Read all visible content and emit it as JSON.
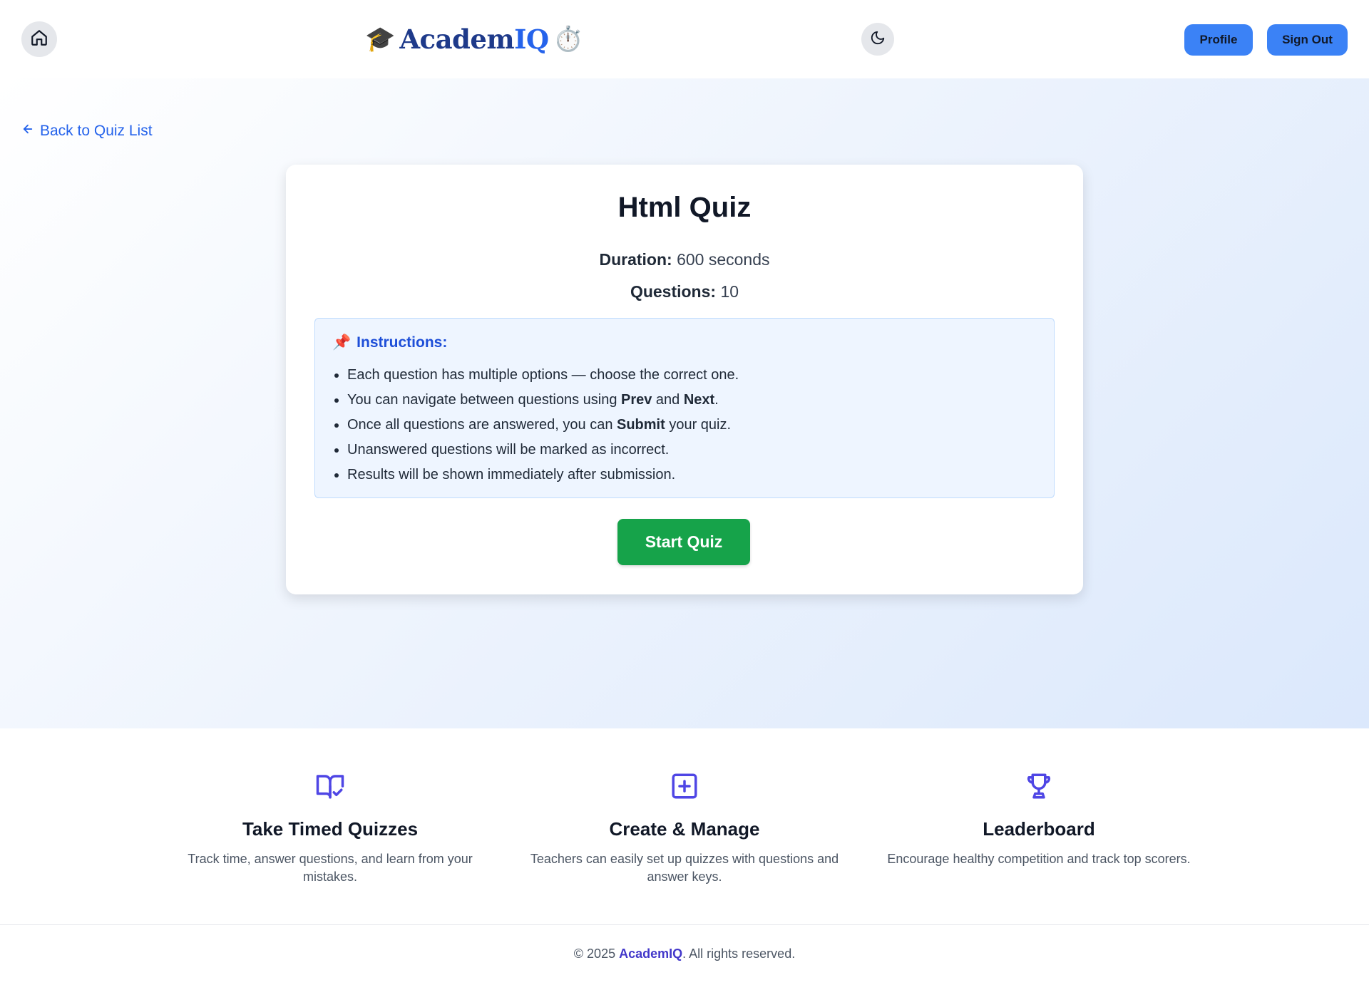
{
  "header": {
    "home_icon": "home-icon",
    "logo": {
      "prefix_emoji": "🎓",
      "brand_main": "Academ",
      "brand_accent": "IQ",
      "suffix_emoji": "⏱️"
    },
    "theme_icon": "moon-icon",
    "profile_label": "Profile",
    "signout_label": "Sign Out",
    "accent_color": "#3b82f6"
  },
  "back_link": {
    "icon": "arrow-left-icon",
    "label": "Back to Quiz List"
  },
  "quiz": {
    "title": "Html Quiz",
    "duration_label": "Duration:",
    "duration_value": "600 seconds",
    "questions_label": "Questions:",
    "questions_value": "10",
    "instructions": {
      "icon": "📌",
      "title": "Instructions:",
      "items": [
        {
          "before": "Each question has multiple options — choose the correct one.",
          "b1": "",
          "mid": "",
          "b2": "",
          "after": ""
        },
        {
          "before": "You can navigate between questions using ",
          "b1": "Prev",
          "mid": " and ",
          "b2": "Next",
          "after": "."
        },
        {
          "before": "Once all questions are answered, you can ",
          "b1": "Submit",
          "mid": " your quiz.",
          "b2": "",
          "after": ""
        },
        {
          "before": "Unanswered questions will be marked as incorrect.",
          "b1": "",
          "mid": "",
          "b2": "",
          "after": ""
        },
        {
          "before": "Results will be shown immediately after submission.",
          "b1": "",
          "mid": "",
          "b2": "",
          "after": ""
        }
      ]
    },
    "start_label": "Start Quiz",
    "start_color": "#16a34a"
  },
  "features": [
    {
      "icon": "book-check-icon",
      "title": "Take Timed Quizzes",
      "desc": "Track time, answer questions, and learn from your mistakes."
    },
    {
      "icon": "plus-square-icon",
      "title": "Create & Manage",
      "desc": "Teachers can easily set up quizzes with questions and answer keys."
    },
    {
      "icon": "trophy-icon",
      "title": "Leaderboard",
      "desc": "Encourage healthy competition and track top scorers."
    }
  ],
  "footer": {
    "prefix": "© 2025 ",
    "brand": "AcademIQ",
    "suffix": ". All rights reserved."
  }
}
